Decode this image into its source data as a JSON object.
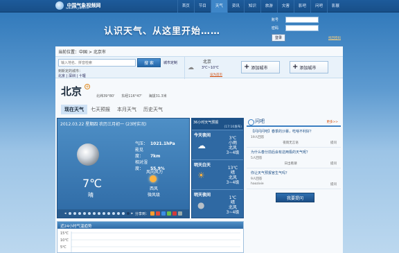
{
  "site": {
    "logo_text": "中国气象视频网",
    "logo_url_text": "www.mywtv.cn"
  },
  "nav": [
    {
      "label": "首页",
      "active": false
    },
    {
      "label": "节目",
      "active": false
    },
    {
      "label": "天气",
      "active": true
    },
    {
      "label": "资讯",
      "active": false
    },
    {
      "label": "知识",
      "active": false
    },
    {
      "label": "旅游",
      "active": false
    },
    {
      "label": "灾害",
      "active": false
    },
    {
      "label": "影吧",
      "active": false
    },
    {
      "label": "问吧",
      "active": false
    },
    {
      "label": "影展",
      "active": false
    }
  ],
  "banner": {
    "slogan": "认识天气、从这里开始……"
  },
  "login": {
    "account_label": "账号",
    "password_label": "密码",
    "login_button": "登录",
    "forgot_link": "找回密码"
  },
  "breadcrumb": "当前位置：中国 > 北京市",
  "search": {
    "placeholder": "输入地名、拼音检索",
    "button": "搜 索",
    "custom_label": "城市定制",
    "quick_label": "到新定的城市：",
    "quick_links": "北京 | 深圳 | 十堰"
  },
  "mini_weather": {
    "city": "北京",
    "temp": "3℃~10℃",
    "set_link": "设为首页"
  },
  "add_city": [
    {
      "label": "添加城市"
    },
    {
      "label": "添加城市"
    }
  ],
  "city": {
    "name": "北京",
    "lat": "北纬39°80'",
    "lon": "东经116°47'",
    "alt": "海拔31.3米"
  },
  "tabs": [
    {
      "label": "现在天气",
      "active": true
    },
    {
      "label": "七天预报",
      "active": false
    },
    {
      "label": "本月天气",
      "active": false
    },
    {
      "label": "历史天气",
      "active": false
    }
  ],
  "current": {
    "datetime": "2012.03.22 星期四 农历三月初一 (23时实况)",
    "pressure_label": "气压：",
    "pressure": "1021.1hPa",
    "visibility_label": "能见度：",
    "visibility": "7km",
    "humidity_label": "相对湿度：",
    "humidity": "55.9%",
    "temp": "7℃",
    "condition": "晴",
    "wind_label": "风向风力",
    "wind_dir": "西风",
    "wind_level": "微风级",
    "share_label": "分享到："
  },
  "forecast": {
    "header": "36小时天气预报",
    "update_time": "(17:10发布)",
    "parts": [
      {
        "title": "今天夜间",
        "temp": "3℃",
        "cond": "小雨",
        "wind": "北风",
        "level": "3~4级",
        "icon": "☁"
      },
      {
        "title": "明天白天",
        "temp": "13℃",
        "cond": "晴",
        "wind": "北风",
        "level": "3~4级",
        "icon": "☀"
      },
      {
        "title": "明天夜间",
        "temp": "1℃",
        "cond": "晴",
        "wind": "北风",
        "level": "3~4级",
        "icon": "●"
      }
    ]
  },
  "qa": {
    "title": "问吧",
    "more": "更多>>",
    "items": [
      {
        "q": "【问问问吧】春季的沙暴，吃啥不利好？",
        "answers": "19人回答",
        "user": "",
        "action": ""
      },
      {
        "q": "",
        "answers": "",
        "user": "夜雨无言语",
        "action": "提问"
      },
      {
        "q": "为什么春分前后会有这两极的天气呢？",
        "answers": "5人回答",
        "user": "日出看潮",
        "action": "提问"
      },
      {
        "q": "你让天气预报官生气吗？",
        "answers": "9人回答",
        "user": "haozixie",
        "action": "提问"
      }
    ],
    "ask_button": "我要提问"
  },
  "chart_data": {
    "type": "line",
    "title": "近24小时气温趋势",
    "y_ticks": [
      "15℃",
      "10℃",
      "5℃"
    ]
  }
}
